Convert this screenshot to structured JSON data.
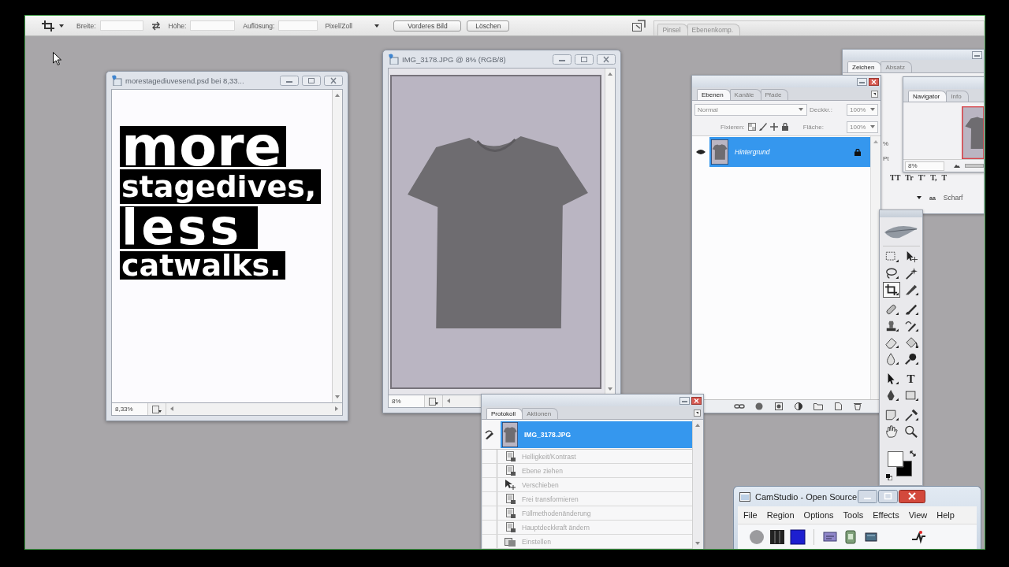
{
  "options_bar": {
    "fields": [
      {
        "label": "Breite:"
      },
      {
        "label": "Höhe:"
      },
      {
        "label": "Auflösung:"
      }
    ],
    "unit": "Pixel/Zoll",
    "buttons": [
      "Vorderes Bild",
      "Löschen"
    ],
    "palette_tabs": [
      {
        "label": "Pinsel",
        "selected": false
      },
      {
        "label": "Ebenenkomp.",
        "selected": false
      }
    ]
  },
  "documents": [
    {
      "kind": "poster",
      "title": "morestagediuvesend.psd bei 8,33...",
      "zoom": "8,33%",
      "poster_lines": [
        "more",
        "stagedives,",
        "less",
        "catwalks."
      ]
    },
    {
      "kind": "photo",
      "title": "IMG_3178.JPG @ 8% (RGB/8)",
      "zoom": "8%"
    }
  ],
  "character_panel": {
    "tabs": [
      {
        "label": "Zeichen",
        "selected": true
      },
      {
        "label": "Absatz",
        "selected": false
      }
    ],
    "field_fragments": [
      "%",
      "Pt"
    ],
    "type_styles": [
      "TT",
      "Tr",
      "T'",
      "T,",
      "T"
    ],
    "antialias_glyph": "aa",
    "antialias": "Scharf"
  },
  "navigator_panel": {
    "tabs": [
      {
        "label": "Navigator",
        "selected": true
      },
      {
        "label": "Info",
        "selected": false
      }
    ],
    "zoom": "8%"
  },
  "layers_panel": {
    "tabs": [
      {
        "label": "Ebenen",
        "selected": true
      },
      {
        "label": "Kanäle",
        "selected": false
      },
      {
        "label": "Pfade",
        "selected": false
      }
    ],
    "blend_mode": "Normal",
    "opacity_label": "Deckkr.:",
    "opacity": "100%",
    "lock_label": "Fixieren:",
    "fill_label": "Fläche:",
    "fill": "100%",
    "layers": [
      {
        "name": "Hintergrund",
        "visible": true,
        "selected": true,
        "locked": true
      }
    ]
  },
  "toolbox": {
    "tools": [
      {
        "kind": "marquee",
        "selected": false
      },
      {
        "kind": "move",
        "selected": false
      },
      {
        "kind": "lasso",
        "selected": false
      },
      {
        "kind": "magic_wand",
        "selected": false
      },
      {
        "kind": "crop",
        "selected": true
      },
      {
        "kind": "slice",
        "selected": false
      },
      {
        "kind": "healing",
        "selected": false
      },
      {
        "kind": "brush",
        "selected": false
      },
      {
        "kind": "stamp",
        "selected": false
      },
      {
        "kind": "history_brush",
        "selected": false
      },
      {
        "kind": "eraser",
        "selected": false
      },
      {
        "kind": "bucket",
        "selected": false
      },
      {
        "kind": "blur",
        "selected": false
      },
      {
        "kind": "dodge",
        "selected": false
      },
      {
        "kind": "path_select",
        "selected": false
      },
      {
        "kind": "type",
        "glyph": "T",
        "selected": false
      },
      {
        "kind": "pen",
        "selected": false
      },
      {
        "kind": "shape",
        "selected": false
      },
      {
        "kind": "notes",
        "selected": false
      },
      {
        "kind": "eyedropper",
        "selected": false
      },
      {
        "kind": "hand",
        "selected": false
      },
      {
        "kind": "zoom",
        "selected": false
      }
    ],
    "swatches": [
      {
        "kind": "foreground",
        "color": "#ffffff"
      },
      {
        "kind": "background",
        "color": "#000000"
      }
    ]
  },
  "history_panel": {
    "tabs": [
      {
        "label": "Protokoll",
        "selected": true
      },
      {
        "label": "Aktionen",
        "selected": false
      }
    ],
    "snapshot": {
      "name": "IMG_3178.JPG",
      "selected": true
    },
    "steps": [
      {
        "name": "Helligkeit/Kontrast",
        "kind": "document",
        "checked": false,
        "dimmed": true
      },
      {
        "name": "Ebene ziehen",
        "kind": "document",
        "checked": false,
        "dimmed": true
      },
      {
        "name": "Verschieben",
        "kind": "move",
        "checked": false,
        "dimmed": true
      },
      {
        "name": "Frei transformieren",
        "kind": "document",
        "checked": false,
        "dimmed": true
      },
      {
        "name": "Füllmethodenänderung",
        "kind": "document",
        "checked": false,
        "dimmed": true
      },
      {
        "name": "Hauptdeckkraft ändern",
        "kind": "document",
        "checked": false,
        "dimmed": true
      },
      {
        "name": "Einstellen",
        "kind": "paste",
        "checked": false,
        "dimmed": true
      }
    ]
  },
  "camstudio_window": {
    "title": "CamStudio - Open Source",
    "menu": [
      "File",
      "Region",
      "Options",
      "Tools",
      "Effects",
      "View",
      "Help"
    ]
  }
}
